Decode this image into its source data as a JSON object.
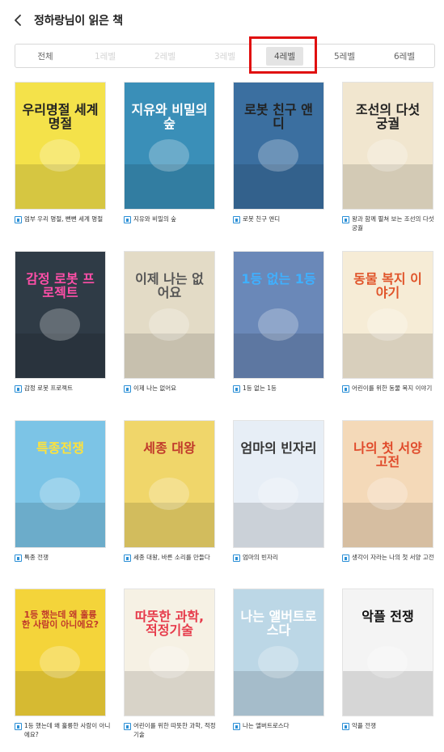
{
  "header": {
    "title": "정하랑님이 읽은 책"
  },
  "tabs": [
    {
      "label": "전체",
      "state": "enabled"
    },
    {
      "label": "1레벨",
      "state": "disabled"
    },
    {
      "label": "2레벨",
      "state": "disabled"
    },
    {
      "label": "3레벨",
      "state": "disabled"
    },
    {
      "label": "4레벨",
      "state": "selected"
    },
    {
      "label": "5레벨",
      "state": "enabled"
    },
    {
      "label": "6레벨",
      "state": "enabled"
    }
  ],
  "books": [
    {
      "title": "엄부 우리 명절, 뻔뻔 세계 명절",
      "cover_text": "우리명절 세계명절",
      "cover_bg": "#f4e24a",
      "cover_fg": "#222222"
    },
    {
      "title": "지유와 비밀의 숲",
      "cover_text": "지유와 비밀의 숲",
      "cover_bg": "#3a8fb8",
      "cover_fg": "#ffffff"
    },
    {
      "title": "로봇 친구 앤디",
      "cover_text": "로봇 친구 앤디",
      "cover_bg": "#3b6fa0",
      "cover_fg": "#222222"
    },
    {
      "title": "왕과 함께 펼쳐 보는 조선의 다섯 궁궐",
      "cover_text": "조선의 다섯 궁궐",
      "cover_bg": "#f1e6cf",
      "cover_fg": "#222222"
    },
    {
      "title": "감정 로봇 프로젝트",
      "cover_text": "감정 로봇 프로젝트",
      "cover_bg": "#2f3b46",
      "cover_fg": "#ff4fa8"
    },
    {
      "title": "이제 나는 없어요",
      "cover_text": "이제 나는 없어요",
      "cover_bg": "#e3dbc6",
      "cover_fg": "#555555"
    },
    {
      "title": "1등 없는 1등",
      "cover_text": "1등 없는 1등",
      "cover_bg": "#6a88b8",
      "cover_fg": "#3fb0ff"
    },
    {
      "title": "어린이를 위한 동물 복지 이야기",
      "cover_text": "동물 복지 이야기",
      "cover_bg": "#f6ecd6",
      "cover_fg": "#e0542a"
    },
    {
      "title": "특종 전쟁",
      "cover_text": "특종전쟁",
      "cover_bg": "#7cc4e6",
      "cover_fg": "#ffe23a"
    },
    {
      "title": "세종 대왕, 바른 소리를 만들다",
      "cover_text": "세종 대왕",
      "cover_bg": "#f0d66a",
      "cover_fg": "#c0392b"
    },
    {
      "title": "엄마의 빈자리",
      "cover_text": "엄마의 빈자리",
      "cover_bg": "#e7eef6",
      "cover_fg": "#333333"
    },
    {
      "title": "생각이 자라는 나의 첫 서양 고전",
      "cover_text": "나의 첫 서양 고전",
      "cover_bg": "#f4d9b8",
      "cover_fg": "#e04a2a"
    },
    {
      "title": "1등 했는데 왜 훌륭한 사람이 아니에요?",
      "cover_text": "1등 했는데 왜 훌륭한 사람이 아니에요?",
      "cover_bg": "#f4d43a",
      "cover_fg": "#c0392b"
    },
    {
      "title": "어린이를 위한 따뜻한 과학, 적정 기술",
      "cover_text": "따뜻한 과학, 적정기술",
      "cover_bg": "#f6f1e4",
      "cover_fg": "#e63a4a"
    },
    {
      "title": "나는 앨버트로스다",
      "cover_text": "나는 앨버트로스다",
      "cover_bg": "#bcd7e6",
      "cover_fg": "#ffffff"
    },
    {
      "title": "악플 전쟁",
      "cover_text": "악플 전쟁",
      "cover_bg": "#f4f4f4",
      "cover_fg": "#111111"
    }
  ],
  "colors": {
    "selection_highlight": "#e01010",
    "ebook_icon": "#2a8fd6"
  },
  "icons": {
    "back": "chevron-left-icon",
    "ebook": "ebook-icon"
  }
}
